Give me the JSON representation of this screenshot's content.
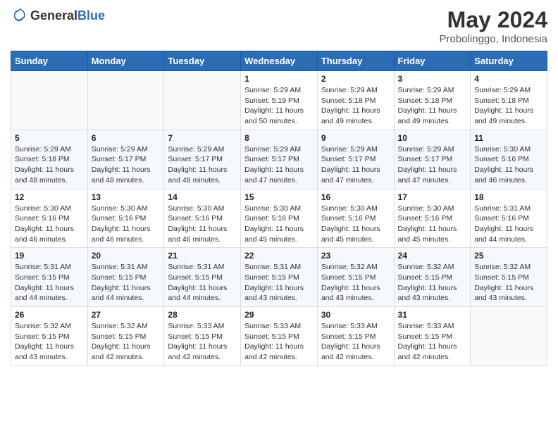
{
  "header": {
    "logo_general": "General",
    "logo_blue": "Blue",
    "title": "May 2024",
    "location": "Probolinggo, Indonesia"
  },
  "days_of_week": [
    "Sunday",
    "Monday",
    "Tuesday",
    "Wednesday",
    "Thursday",
    "Friday",
    "Saturday"
  ],
  "weeks": [
    [
      {
        "day": "",
        "info": ""
      },
      {
        "day": "",
        "info": ""
      },
      {
        "day": "",
        "info": ""
      },
      {
        "day": "1",
        "info": "Sunrise: 5:29 AM\nSunset: 5:19 PM\nDaylight: 11 hours\nand 50 minutes."
      },
      {
        "day": "2",
        "info": "Sunrise: 5:29 AM\nSunset: 5:18 PM\nDaylight: 11 hours\nand 49 minutes."
      },
      {
        "day": "3",
        "info": "Sunrise: 5:29 AM\nSunset: 5:18 PM\nDaylight: 11 hours\nand 49 minutes."
      },
      {
        "day": "4",
        "info": "Sunrise: 5:29 AM\nSunset: 5:18 PM\nDaylight: 11 hours\nand 49 minutes."
      }
    ],
    [
      {
        "day": "5",
        "info": "Sunrise: 5:29 AM\nSunset: 5:18 PM\nDaylight: 11 hours\nand 48 minutes."
      },
      {
        "day": "6",
        "info": "Sunrise: 5:29 AM\nSunset: 5:17 PM\nDaylight: 11 hours\nand 48 minutes."
      },
      {
        "day": "7",
        "info": "Sunrise: 5:29 AM\nSunset: 5:17 PM\nDaylight: 11 hours\nand 48 minutes."
      },
      {
        "day": "8",
        "info": "Sunrise: 5:29 AM\nSunset: 5:17 PM\nDaylight: 11 hours\nand 47 minutes."
      },
      {
        "day": "9",
        "info": "Sunrise: 5:29 AM\nSunset: 5:17 PM\nDaylight: 11 hours\nand 47 minutes."
      },
      {
        "day": "10",
        "info": "Sunrise: 5:29 AM\nSunset: 5:17 PM\nDaylight: 11 hours\nand 47 minutes."
      },
      {
        "day": "11",
        "info": "Sunrise: 5:30 AM\nSunset: 5:16 PM\nDaylight: 11 hours\nand 46 minutes."
      }
    ],
    [
      {
        "day": "12",
        "info": "Sunrise: 5:30 AM\nSunset: 5:16 PM\nDaylight: 11 hours\nand 46 minutes."
      },
      {
        "day": "13",
        "info": "Sunrise: 5:30 AM\nSunset: 5:16 PM\nDaylight: 11 hours\nand 46 minutes."
      },
      {
        "day": "14",
        "info": "Sunrise: 5:30 AM\nSunset: 5:16 PM\nDaylight: 11 hours\nand 46 minutes."
      },
      {
        "day": "15",
        "info": "Sunrise: 5:30 AM\nSunset: 5:16 PM\nDaylight: 11 hours\nand 45 minutes."
      },
      {
        "day": "16",
        "info": "Sunrise: 5:30 AM\nSunset: 5:16 PM\nDaylight: 11 hours\nand 45 minutes."
      },
      {
        "day": "17",
        "info": "Sunrise: 5:30 AM\nSunset: 5:16 PM\nDaylight: 11 hours\nand 45 minutes."
      },
      {
        "day": "18",
        "info": "Sunrise: 5:31 AM\nSunset: 5:16 PM\nDaylight: 11 hours\nand 44 minutes."
      }
    ],
    [
      {
        "day": "19",
        "info": "Sunrise: 5:31 AM\nSunset: 5:15 PM\nDaylight: 11 hours\nand 44 minutes."
      },
      {
        "day": "20",
        "info": "Sunrise: 5:31 AM\nSunset: 5:15 PM\nDaylight: 11 hours\nand 44 minutes."
      },
      {
        "day": "21",
        "info": "Sunrise: 5:31 AM\nSunset: 5:15 PM\nDaylight: 11 hours\nand 44 minutes."
      },
      {
        "day": "22",
        "info": "Sunrise: 5:31 AM\nSunset: 5:15 PM\nDaylight: 11 hours\nand 43 minutes."
      },
      {
        "day": "23",
        "info": "Sunrise: 5:32 AM\nSunset: 5:15 PM\nDaylight: 11 hours\nand 43 minutes."
      },
      {
        "day": "24",
        "info": "Sunrise: 5:32 AM\nSunset: 5:15 PM\nDaylight: 11 hours\nand 43 minutes."
      },
      {
        "day": "25",
        "info": "Sunrise: 5:32 AM\nSunset: 5:15 PM\nDaylight: 11 hours\nand 43 minutes."
      }
    ],
    [
      {
        "day": "26",
        "info": "Sunrise: 5:32 AM\nSunset: 5:15 PM\nDaylight: 11 hours\nand 43 minutes."
      },
      {
        "day": "27",
        "info": "Sunrise: 5:32 AM\nSunset: 5:15 PM\nDaylight: 11 hours\nand 42 minutes."
      },
      {
        "day": "28",
        "info": "Sunrise: 5:33 AM\nSunset: 5:15 PM\nDaylight: 11 hours\nand 42 minutes."
      },
      {
        "day": "29",
        "info": "Sunrise: 5:33 AM\nSunset: 5:15 PM\nDaylight: 11 hours\nand 42 minutes."
      },
      {
        "day": "30",
        "info": "Sunrise: 5:33 AM\nSunset: 5:15 PM\nDaylight: 11 hours\nand 42 minutes."
      },
      {
        "day": "31",
        "info": "Sunrise: 5:33 AM\nSunset: 5:15 PM\nDaylight: 11 hours\nand 42 minutes."
      },
      {
        "day": "",
        "info": ""
      }
    ]
  ]
}
